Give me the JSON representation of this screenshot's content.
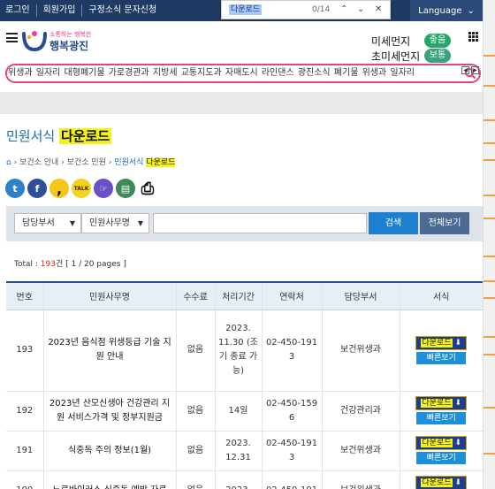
{
  "topbar": {
    "links": [
      "로그인",
      "회원가입",
      "구정소식 문자신청"
    ],
    "language": "Language"
  },
  "findbar": {
    "query": "다운로드",
    "count": "0/14"
  },
  "header": {
    "logo_sub": "소통하는 행복한",
    "logo_name": "행복광진",
    "dust_label": "미세먼지",
    "dust_status": "좋음",
    "ultra_dust_label": "초미세먼지",
    "ultra_dust_status": "보통"
  },
  "subnav": "위생과 일자리 대형폐기물 가로경관과 지방세 교통지도과 자매도시 라인댄스 광진소식 폐기물 위생과 일자리",
  "page": {
    "title_prefix": "민원서식",
    "title_highlight": "다운로드",
    "breadcrumb": [
      "보건소 안내",
      "보건소 민원"
    ],
    "breadcrumb_current_prefix": "민원서식",
    "breadcrumb_current_highlight": "다운로드"
  },
  "share_icons": [
    {
      "name": "twitter-icon",
      "glyph": "t",
      "color": "#2f7fc9"
    },
    {
      "name": "facebook-icon",
      "glyph": "f",
      "color": "#2b4f9b"
    },
    {
      "name": "kakaostory-icon",
      "glyph": ",",
      "color": "#1a1a1a"
    },
    {
      "name": "kakaotalk-icon",
      "glyph": "TALK",
      "color": "#f4d21c"
    },
    {
      "name": "band-icon",
      "glyph": "☞",
      "color": "#6b4fc9"
    },
    {
      "name": "document-icon",
      "glyph": "▤",
      "color": "#3d8a54"
    },
    {
      "name": "print-icon",
      "glyph": "⎙",
      "color": "#111111"
    }
  ],
  "search_form": {
    "dept_select": "담당부서",
    "form_select": "민원사무명",
    "search_button": "검색",
    "all_button": "전체보기"
  },
  "total": {
    "label": "Total :",
    "count": "193",
    "unit": "건",
    "pages": "[ 1 / 20 pages ]"
  },
  "table": {
    "headers": [
      "번호",
      "민원사무명",
      "수수료",
      "처리기간",
      "연락처",
      "담당부서",
      "서식"
    ],
    "download_label": "다운로드",
    "quickview_label": "빠른보기",
    "rows": [
      {
        "no": "193",
        "name": "2023년 음식점 위생등급 기술 지원 안내",
        "fee": "없음",
        "period": "2023. 11.30 (조기 종료 가 능)",
        "phone": "02-450-191 3",
        "dept": "보건위생과"
      },
      {
        "no": "192",
        "name": "2023년 산모신생아 건강관리 지원 서비스가격 및 정부지원금",
        "fee": "없음",
        "period": "14일",
        "phone": "02-450-159 6",
        "dept": "건강관리과"
      },
      {
        "no": "191",
        "name": "식중독 주의 정보(1월)",
        "fee": "없음",
        "period": "2023. 12.31",
        "phone": "02-450-191 3",
        "dept": "보건위생과"
      },
      {
        "no": "190",
        "name": "노로바이러스 식중독 예방 자료",
        "fee": "없음",
        "period": "2023.",
        "phone": "02-450-191",
        "dept": "보건위생과"
      }
    ]
  },
  "colors": {
    "topbar": "#1f3b63",
    "accent_pink": "#e0467b",
    "link_blue": "#1a6bb8",
    "highlight": "#f5f219",
    "good": "#27a86a"
  }
}
